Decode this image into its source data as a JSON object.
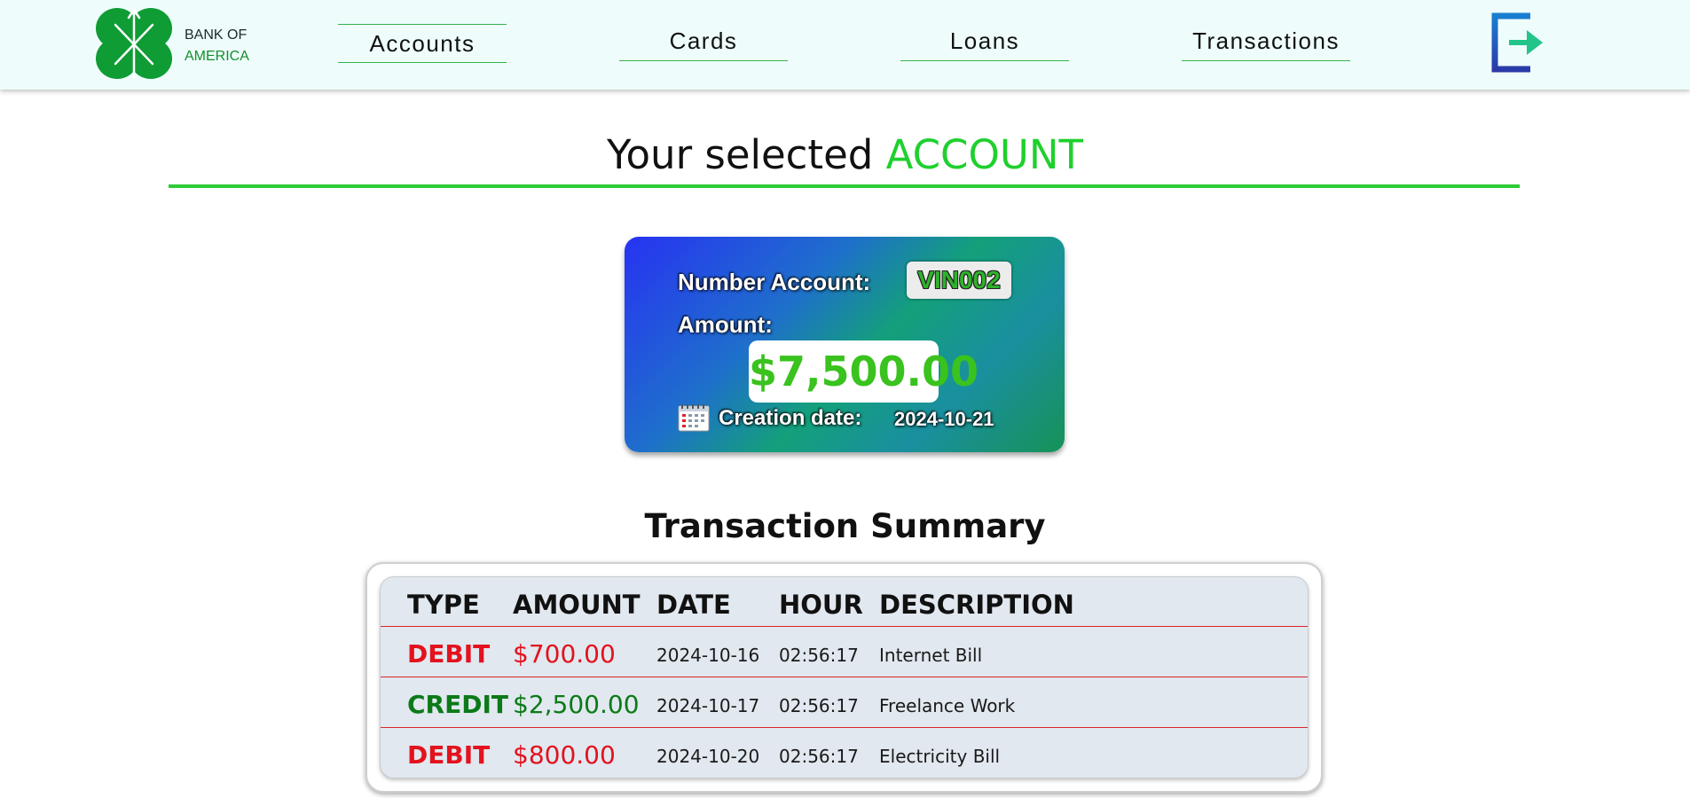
{
  "brand": {
    "line1": "BANK OF",
    "line2": "AMERICA"
  },
  "nav": {
    "items": [
      {
        "label": "Accounts",
        "active": true
      },
      {
        "label": "Cards",
        "active": false
      },
      {
        "label": "Loans",
        "active": false
      },
      {
        "label": "Transactions",
        "active": false
      }
    ],
    "logout_icon": "logout-icon"
  },
  "page": {
    "title_prefix": "Your selected",
    "title_accent": "ACCOUNT"
  },
  "account": {
    "number_label": "Number Account:",
    "number": "VIN002",
    "amount_label": "Amount:",
    "amount": "$7,500.00",
    "creation_label": "Creation date:",
    "creation_date": "2024-10-21",
    "calendar_icon": "calendar-icon"
  },
  "summary": {
    "title": "Transaction Summary",
    "headers": [
      "TYPE",
      "AMOUNT",
      "DATE",
      "HOUR",
      "DESCRIPTION"
    ],
    "rows": [
      {
        "type": "DEBIT",
        "amount": "$700.00",
        "date": "2024-10-16",
        "hour": "02:56:17",
        "description": "Internet Bill"
      },
      {
        "type": "CREDIT",
        "amount": "$2,500.00",
        "date": "2024-10-17",
        "hour": "02:56:17",
        "description": "Freelance Work"
      },
      {
        "type": "DEBIT",
        "amount": "$800.00",
        "date": "2024-10-20",
        "hour": "02:56:17",
        "description": "Electricity Bill"
      }
    ]
  },
  "colors": {
    "nav_bg": "#eefdfb",
    "accent_green": "#1fd02e",
    "debit": "#e3121e",
    "credit": "#0b7a17",
    "table_bg": "#e1e8ef"
  }
}
